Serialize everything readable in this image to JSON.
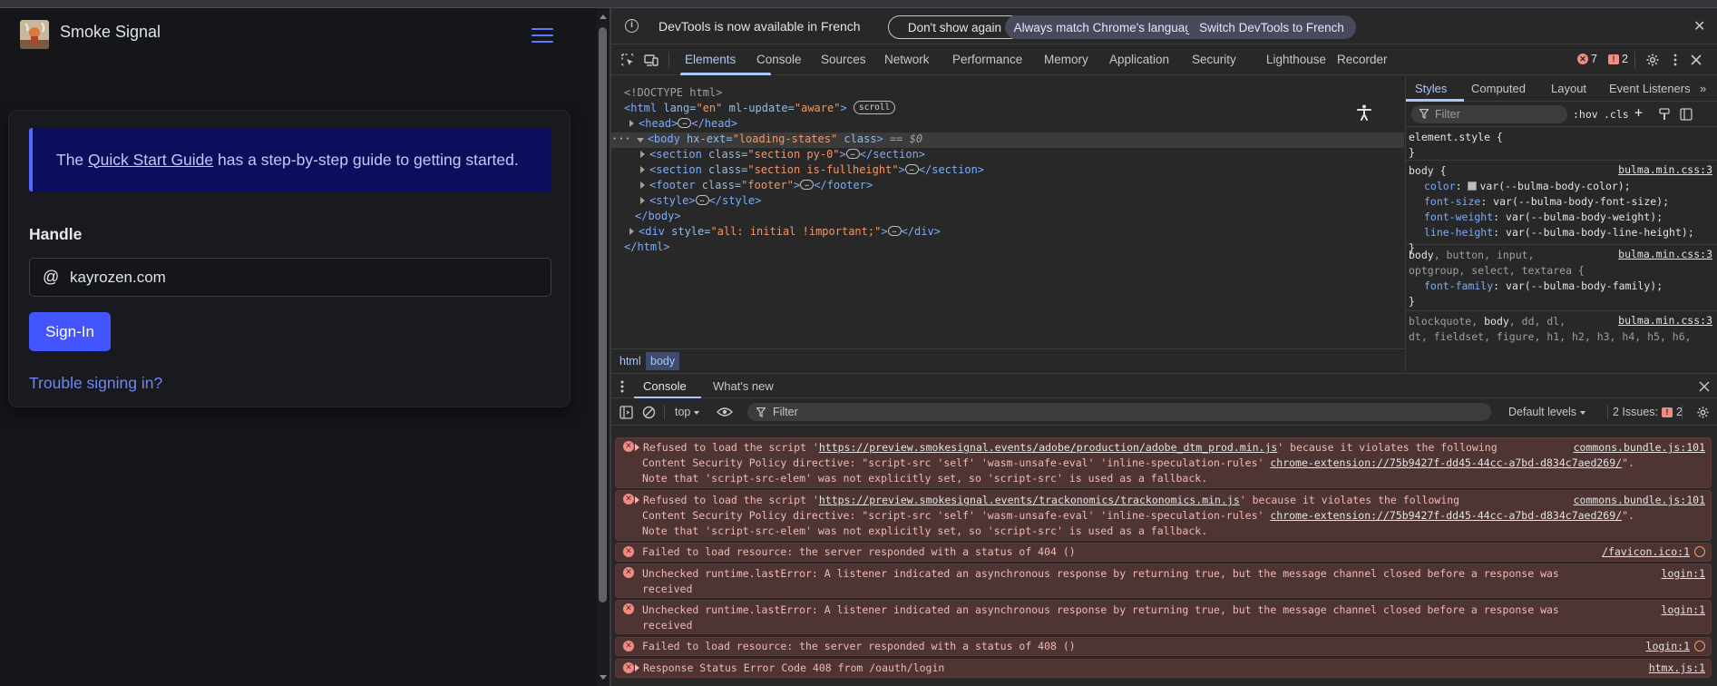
{
  "page": {
    "brand": "Smoke Signal",
    "notice": {
      "before": "The ",
      "link": "Quick Start Guide",
      "after": " has a step-by-step guide to getting started."
    },
    "handle_label": "Handle",
    "at_symbol": "@",
    "handle_value": "kayrozen.com",
    "signin_label": "Sign-In",
    "trouble_label": "Trouble signing in?"
  },
  "devtools": {
    "infobar": {
      "text": "DevTools is now available in French",
      "dont_show": "Don't show again",
      "match_language": "Always match Chrome's language",
      "switch_french": "Switch DevTools to French",
      "close": "✕"
    },
    "tabs": [
      "Elements",
      "Console",
      "Sources",
      "Network",
      "Performance",
      "Memory",
      "Application",
      "Security",
      "Lighthouse",
      "Recorder"
    ],
    "error_count": "7",
    "issue_count": "2",
    "dom": {
      "doctype": "<!DOCTYPE html>",
      "html_open": {
        "tag": "<html",
        "a1": " lang=",
        "v1": "\"en\"",
        "a2": " ml-update=",
        "v2": "\"aware\"",
        "end": ">",
        "badge": "scroll"
      },
      "head": {
        "open": "<head>",
        "close": "</head>"
      },
      "body": {
        "tag": "<body",
        "a1": " hx-ext=",
        "v1": "\"loading-states\"",
        "a2": " class",
        "end": ">",
        "eq": " == $0"
      },
      "section1": {
        "tag": "<section",
        "a1": " class=",
        "v1": "\"section py-0\"",
        "end": ">",
        "close": "</section>"
      },
      "section2": {
        "tag": "<section",
        "a1": " class=",
        "v1": "\"section is-fullheight\"",
        "end": ">",
        "close": "</section>"
      },
      "footer": {
        "tag": "<footer",
        "a1": " class=",
        "v1": "\"footer\"",
        "end": ">",
        "close": "</footer>"
      },
      "style": {
        "open": "<style>",
        "close": "</style>"
      },
      "body_close": "</body>",
      "div": {
        "tag": "<div",
        "a1": " style=",
        "v1": "\"all: initial !important;\"",
        "end": ">",
        "close": "</div>"
      },
      "html_close": "</html>"
    },
    "breadcrumbs": [
      "html",
      "body"
    ],
    "styles": {
      "subtabs": [
        "Styles",
        "Computed",
        "Layout",
        "Event Listeners"
      ],
      "filter_placeholder": "Filter",
      "hov": ":hov",
      "cls": ".cls",
      "element_style": "element.style {",
      "rules": [
        {
          "selector": "body {",
          "source": "bulma.min.css:3",
          "props": [
            {
              "name": "color",
              "value": "var(--bulma-body-color);"
            },
            {
              "name": "font-size",
              "value": "var(--bulma-body-font-size);"
            },
            {
              "name": "font-weight",
              "value": "var(--bulma-body-weight);"
            },
            {
              "name": "line-height",
              "value": "var(--bulma-body-line-height);"
            }
          ]
        },
        {
          "selector_main": "body",
          "selector_rest": ", button, input,",
          "selector_line2": "optgroup, select, textarea {",
          "source": "bulma.min.css:3",
          "props": [
            {
              "name": "font-family",
              "value": "var(--bulma-body-family);"
            }
          ]
        },
        {
          "selector_pre": "blockquote, ",
          "selector_main": "body",
          "selector_rest": ", dd, dl,",
          "selector_line2": "dt, fieldset, figure, h1, h2, h3, h4, h5, h6,",
          "source": "bulma.min.css:3"
        }
      ],
      "close_brace": "}"
    },
    "drawer_tabs": [
      "Console",
      "What's new"
    ],
    "console_toolbar": {
      "context": "top",
      "filter_placeholder": "Filter",
      "levels": "Default levels",
      "issues_label": "2 Issues:",
      "issues_count": "2"
    },
    "messages": [
      {
        "l1a": "Refused to load the script '",
        "l1url": "https://preview.smokesignal.events/adobe/production/adobe_dtm_prod.min.js",
        "l1b": "' because it violates the following",
        "l2a": "Content Security Policy directive: \"script-src 'self' 'wasm-unsafe-eval' 'inline-speculation-rules' ",
        "l2url": "chrome-extension://75b9427f-dd45-44cc-a7bd-d834c7aed269/",
        "l2b": "\".",
        "l3": "Note that 'script-src-elem' was not explicitly set, so 'script-src' is used as a fallback.",
        "source": "commons.bundle.js:101"
      },
      {
        "l1a": "Refused to load the script '",
        "l1url": "https://preview.smokesignal.events/trackonomics/trackonomics.min.js",
        "l1b": "' because it violates the following",
        "l2a": "Content Security Policy directive: \"script-src 'self' 'wasm-unsafe-eval' 'inline-speculation-rules' ",
        "l2url": "chrome-extension://75b9427f-dd45-44cc-a7bd-d834c7aed269/",
        "l2b": "\".",
        "l3": "Note that 'script-src-elem' was not explicitly set, so 'script-src' is used as a fallback.",
        "source": "commons.bundle.js:101"
      },
      {
        "text": "Failed to load resource: the server responded with a status of 404 ()",
        "source": "/favicon.ico:1"
      },
      {
        "l1": "Unchecked runtime.lastError: A listener indicated an asynchronous response by returning true, but the message channel closed before a response was",
        "l2": "received",
        "source": "login:1"
      },
      {
        "l1": "Unchecked runtime.lastError: A listener indicated an asynchronous response by returning true, but the message channel closed before a response was",
        "l2": "received",
        "source": "login:1"
      },
      {
        "text": "Failed to load resource: the server responded with a status of 408 ()",
        "source": "login:1"
      },
      {
        "text": "Response Status Error Code 408 from /oauth/login",
        "source": "htmx.js:1"
      }
    ]
  },
  "colors": {
    "accent_blue": "#4255ff",
    "devtools_accent": "#a8c7fa",
    "error_bg": "#4e3534",
    "error_text": "#f2b8b5"
  }
}
